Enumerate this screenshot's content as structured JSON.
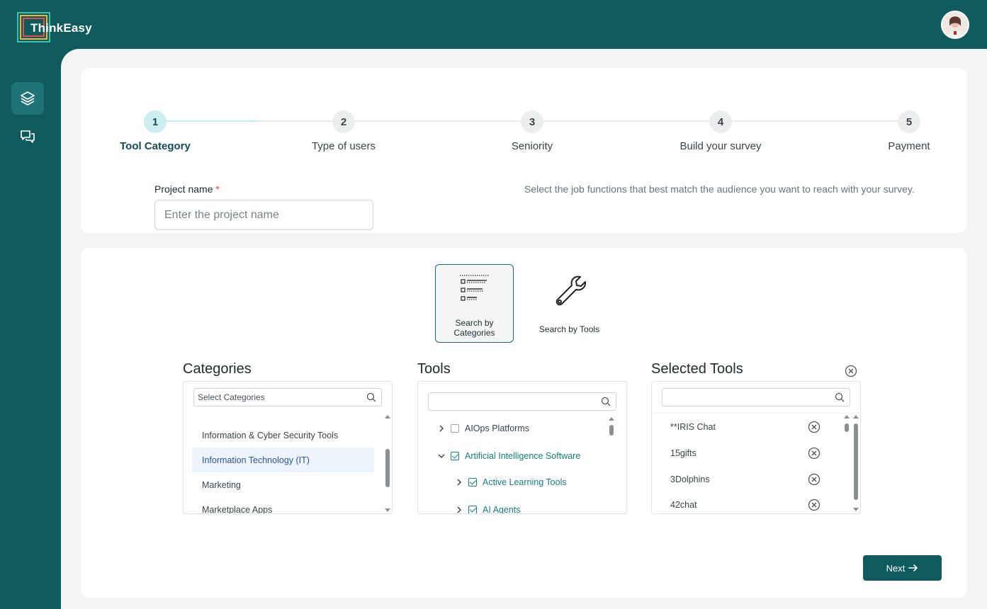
{
  "app": {
    "name": "ThinkEasy"
  },
  "colors": {
    "brand": "#0f5a5c",
    "accent": "#15807e",
    "selected_text": "#2a54a6"
  },
  "sidebar": {
    "items": [
      {
        "icon": "layers-icon",
        "active": true
      },
      {
        "icon": "chat-icon",
        "active": false
      }
    ]
  },
  "stepper": {
    "steps": [
      {
        "number": "1",
        "label": "Tool Category",
        "active": true
      },
      {
        "number": "2",
        "label": "Type of users",
        "active": false
      },
      {
        "number": "3",
        "label": "Seniority",
        "active": false
      },
      {
        "number": "4",
        "label": "Build your survey",
        "active": false
      },
      {
        "number": "5",
        "label": "Payment",
        "active": false
      }
    ]
  },
  "project": {
    "label": "Project name",
    "required_mark": "*",
    "placeholder": "Enter the project name",
    "value": ""
  },
  "hint": "Select the job functions that best match the audience you want to reach with your survey.",
  "modes": [
    {
      "label": "Search by Categories",
      "icon": "list-icon",
      "active": true
    },
    {
      "label": "Search by Tools",
      "icon": "wrench-icon",
      "active": false
    }
  ],
  "categories": {
    "title": "Categories",
    "search_placeholder": "Select Categories",
    "items": [
      {
        "label": "Information & Cyber Security Tools",
        "selected": false
      },
      {
        "label": "Information Technology (IT)",
        "selected": true
      },
      {
        "label": "Marketing",
        "selected": false
      },
      {
        "label": "Marketplace Apps",
        "selected": false
      }
    ]
  },
  "tools": {
    "title": "Tools",
    "search_placeholder": "",
    "items": [
      {
        "label": "AIOps Platforms",
        "checked": false,
        "expanded": false,
        "level": 0
      },
      {
        "label": "Artificial Intelligence Software",
        "checked": true,
        "expanded": true,
        "level": 0
      },
      {
        "label": "Active Learning Tools",
        "checked": true,
        "expanded": false,
        "level": 1
      },
      {
        "label": "AI Agents",
        "checked": true,
        "expanded": false,
        "level": 1
      }
    ]
  },
  "selected_tools": {
    "title": "Selected Tools",
    "search_placeholder": "",
    "items": [
      {
        "label": "**IRIS Chat"
      },
      {
        "label": "15gifts"
      },
      {
        "label": "3Dolphins"
      },
      {
        "label": "42chat"
      }
    ]
  },
  "actions": {
    "next_label": "Next"
  }
}
